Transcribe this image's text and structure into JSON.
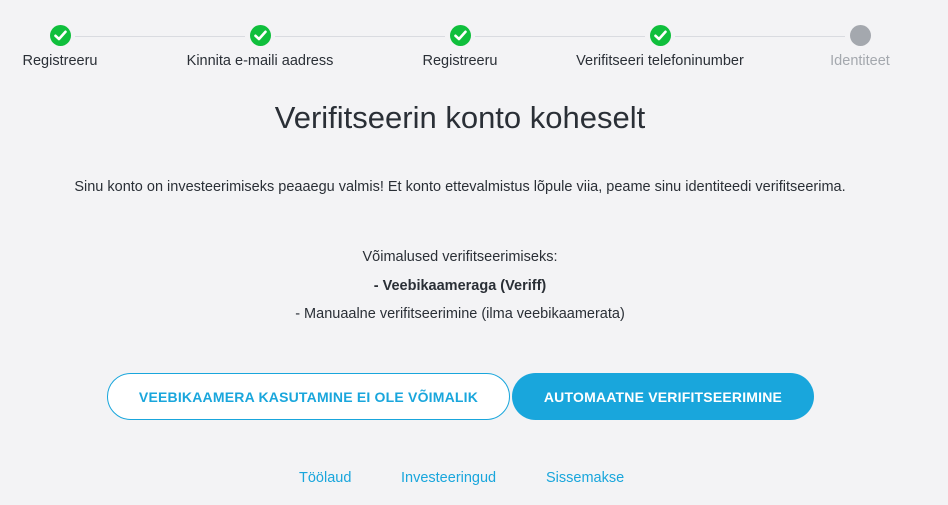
{
  "stepper": {
    "steps": [
      {
        "label": "Registreeru",
        "status": "done"
      },
      {
        "label": "Kinnita e-maili aadress",
        "status": "done"
      },
      {
        "label": "Registreeru",
        "status": "done"
      },
      {
        "label": "Verifitseeri telefoninumber",
        "status": "done"
      },
      {
        "label": "Identiteet",
        "status": "pending"
      }
    ]
  },
  "main": {
    "title": "Verifitseerin konto koheselt",
    "intro": "Sinu konto on investeerimiseks peaaegu valmis! Et konto ettevalmistus lõpule viia, peame sinu identiteedi verifitseerima.",
    "options_heading": "Võimalused verifitseerimiseks:",
    "option_1": "- Veebikaameraga (Veriff)",
    "option_2": "- Manuaalne verifitseerimine (ilma veebikaamerata)"
  },
  "buttons": {
    "no_webcam": "VEEBIKAAMERA KASUTAMINE EI OLE VÕIMALIK",
    "auto_verify": "AUTOMAATNE VERIFITSEERIMINE"
  },
  "footer": {
    "links": [
      "Töölaud",
      "Investeeringud",
      "Sissemakse"
    ]
  },
  "colors": {
    "done": "#0fbf3c",
    "pending": "#a4a8ae",
    "accent": "#19a6dc",
    "background": "#f3f3f5",
    "text": "#2a2f36"
  }
}
